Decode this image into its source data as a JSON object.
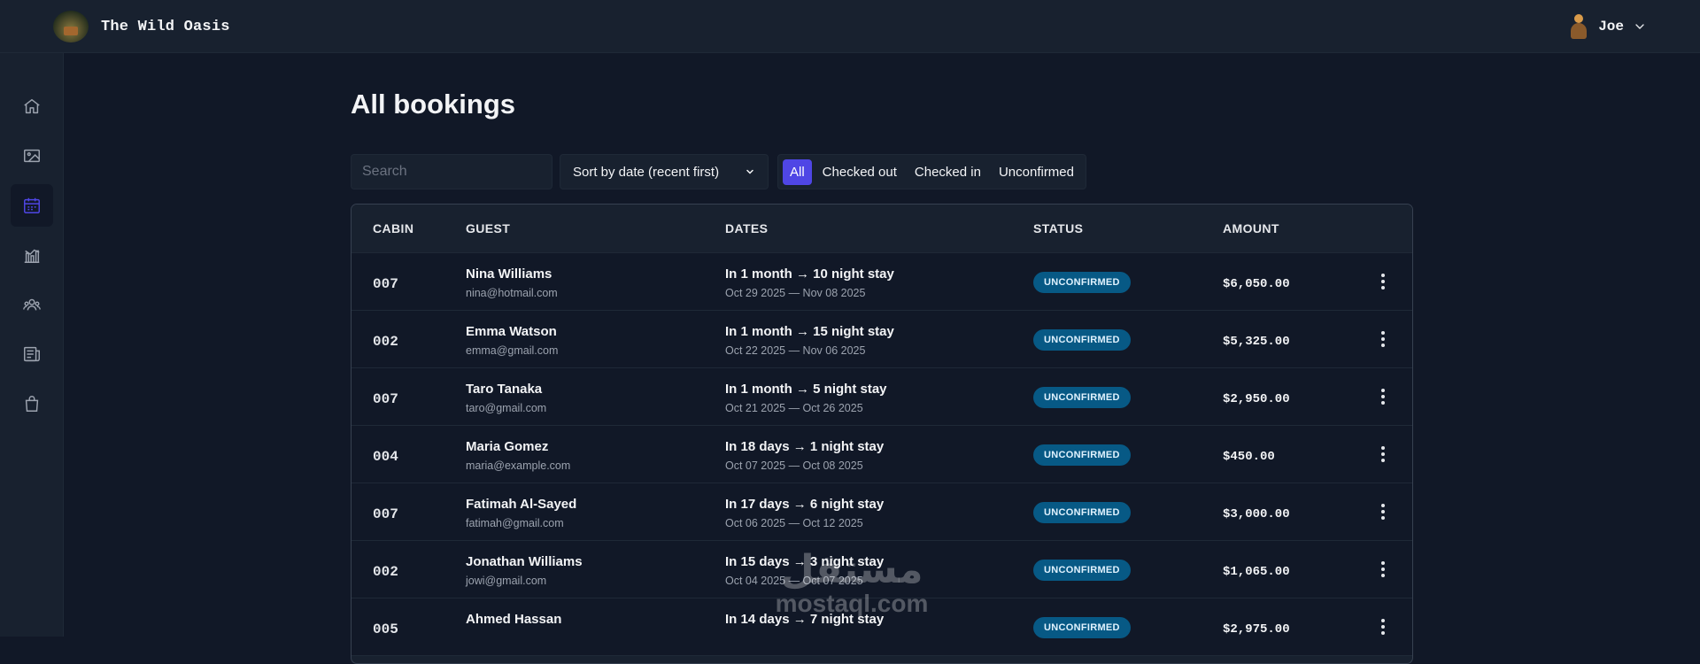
{
  "app": {
    "name": "The Wild Oasis"
  },
  "user": {
    "name": "Joe"
  },
  "sidebar": {
    "items": [
      {
        "icon": "home-icon"
      },
      {
        "icon": "image-icon"
      },
      {
        "icon": "calendar-icon",
        "active": true
      },
      {
        "icon": "chart-icon"
      },
      {
        "icon": "users-icon"
      },
      {
        "icon": "newspaper-icon"
      },
      {
        "icon": "shopping-bag-icon"
      }
    ]
  },
  "page": {
    "title": "All bookings"
  },
  "search": {
    "placeholder": "Search"
  },
  "sort": {
    "selected": "Sort by date (recent first)"
  },
  "filters": {
    "items": [
      "All",
      "Checked out",
      "Checked in",
      "Unconfirmed"
    ],
    "active": "All"
  },
  "table": {
    "headers": [
      "CABIN",
      "GUEST",
      "DATES",
      "STATUS",
      "AMOUNT"
    ],
    "rows": [
      {
        "cabin": "007",
        "guest_name": "Nina Williams",
        "guest_email": "nina@hotmail.com",
        "stay": "In 1 month → 10 night stay",
        "range": "Oct 29 2025 — Nov 08 2025",
        "status": "UNCONFIRMED",
        "amount": "$6,050.00"
      },
      {
        "cabin": "002",
        "guest_name": "Emma Watson",
        "guest_email": "emma@gmail.com",
        "stay": "In 1 month → 15 night stay",
        "range": "Oct 22 2025 — Nov 06 2025",
        "status": "UNCONFIRMED",
        "amount": "$5,325.00"
      },
      {
        "cabin": "007",
        "guest_name": "Taro Tanaka",
        "guest_email": "taro@gmail.com",
        "stay": "In 1 month → 5 night stay",
        "range": "Oct 21 2025 — Oct 26 2025",
        "status": "UNCONFIRMED",
        "amount": "$2,950.00"
      },
      {
        "cabin": "004",
        "guest_name": "Maria Gomez",
        "guest_email": "maria@example.com",
        "stay": "In 18 days → 1 night stay",
        "range": "Oct 07 2025 — Oct 08 2025",
        "status": "UNCONFIRMED",
        "amount": "$450.00"
      },
      {
        "cabin": "007",
        "guest_name": "Fatimah Al-Sayed",
        "guest_email": "fatimah@gmail.com",
        "stay": "In 17 days → 6 night stay",
        "range": "Oct 06 2025 — Oct 12 2025",
        "status": "UNCONFIRMED",
        "amount": "$3,000.00"
      },
      {
        "cabin": "002",
        "guest_name": "Jonathan Williams",
        "guest_email": "jowi@gmail.com",
        "stay": "In 15 days → 3 night stay",
        "range": "Oct 04 2025 — Oct 07 2025",
        "status": "UNCONFIRMED",
        "amount": "$1,065.00"
      },
      {
        "cabin": "005",
        "guest_name": "Ahmed Hassan",
        "guest_email": "",
        "stay": "In 14 days → 7 night stay",
        "range": "",
        "status": "UNCONFIRMED",
        "amount": "$2,975.00"
      }
    ]
  },
  "watermark": {
    "arabic": "مستقل",
    "latin": "mostaql.com"
  },
  "colors": {
    "accent": "#4f46e5",
    "status_badge": "#075985",
    "bg": "#111827",
    "panel": "#18212f"
  }
}
